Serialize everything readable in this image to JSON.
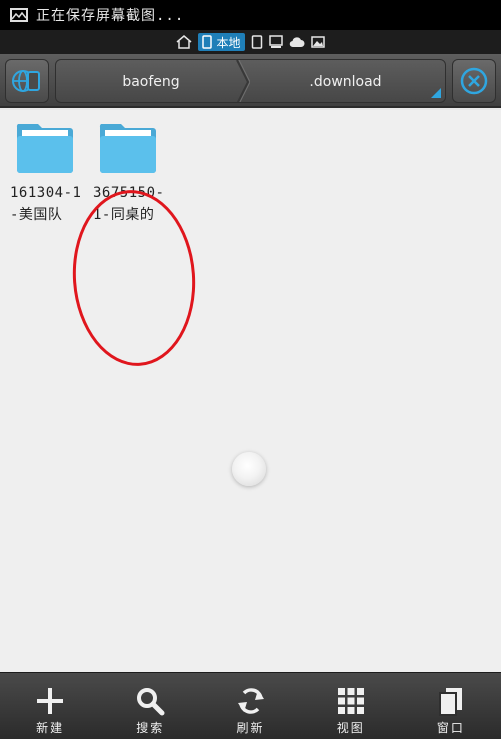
{
  "status_bar": {
    "text": "正在保存屏幕截图..."
  },
  "location_bar": {
    "items": [
      {
        "icon": "home-icon"
      },
      {
        "icon": "phone-icon",
        "label": "本地",
        "active": true
      },
      {
        "icon": "tablet-icon"
      },
      {
        "icon": "computer-icon"
      },
      {
        "icon": "cloud-icon"
      },
      {
        "icon": "picture-icon"
      }
    ]
  },
  "toolbar": {
    "left_icon": "network-device-icon",
    "right_icon": "close-circle-icon",
    "breadcrumbs": [
      "baofeng",
      ".download"
    ]
  },
  "files": [
    {
      "line1": "161304-1",
      "line2": "-美国队"
    },
    {
      "line1": "3675150-",
      "line2": "1-同桌的"
    }
  ],
  "bottom_bar": {
    "buttons": [
      {
        "label": "新建",
        "icon": "plus-icon"
      },
      {
        "label": "搜索",
        "icon": "search-icon"
      },
      {
        "label": "刷新",
        "icon": "refresh-icon"
      },
      {
        "label": "视图",
        "icon": "grid-view-icon"
      },
      {
        "label": "窗口",
        "icon": "windows-icon"
      }
    ]
  },
  "colors": {
    "accent": "#2fa6e0",
    "folder": "#5bc0ec",
    "annotation": "#e0161d"
  }
}
